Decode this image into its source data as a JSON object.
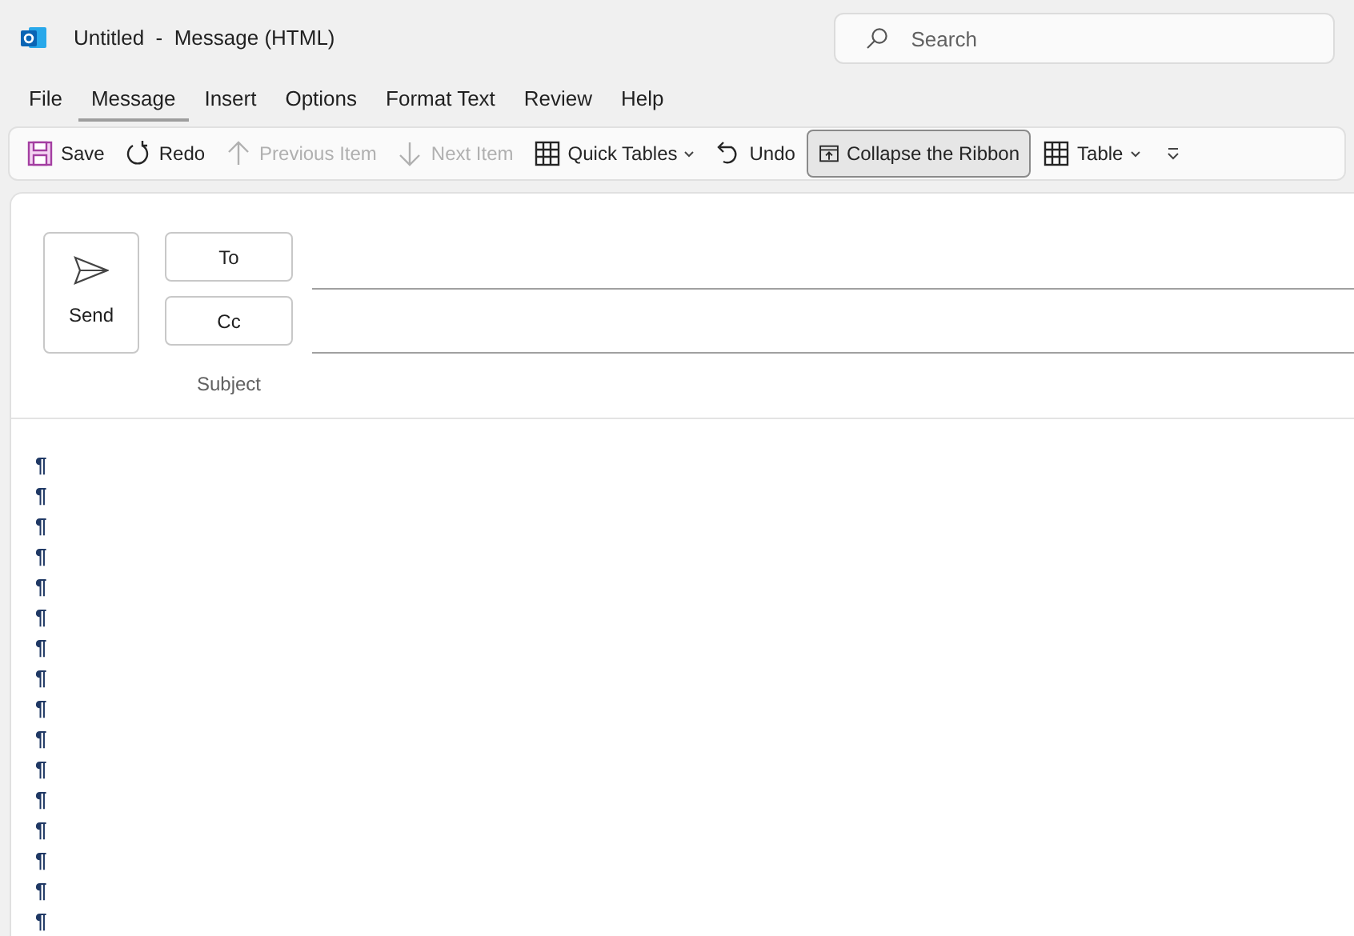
{
  "window": {
    "title": "Untitled  -  Message (HTML)"
  },
  "search": {
    "placeholder": "Search"
  },
  "tabs": [
    {
      "label": "File",
      "selected": false
    },
    {
      "label": "Message",
      "selected": true
    },
    {
      "label": "Insert",
      "selected": false
    },
    {
      "label": "Options",
      "selected": false
    },
    {
      "label": "Format Text",
      "selected": false
    },
    {
      "label": "Review",
      "selected": false
    },
    {
      "label": "Help",
      "selected": false
    }
  ],
  "toolbar": [
    {
      "label": "Save",
      "disabled": false,
      "pressed": false,
      "dropdown": false
    },
    {
      "label": "Redo",
      "disabled": false,
      "pressed": false,
      "dropdown": false
    },
    {
      "label": "Previous Item",
      "disabled": true,
      "pressed": false,
      "dropdown": false
    },
    {
      "label": "Next Item",
      "disabled": true,
      "pressed": false,
      "dropdown": false
    },
    {
      "label": "Quick Tables",
      "disabled": false,
      "pressed": false,
      "dropdown": true
    },
    {
      "label": "Undo",
      "disabled": false,
      "pressed": false,
      "dropdown": false
    },
    {
      "label": "Collapse the Ribbon",
      "disabled": false,
      "pressed": true,
      "dropdown": false
    },
    {
      "label": "Table",
      "disabled": false,
      "pressed": false,
      "dropdown": true
    }
  ],
  "compose": {
    "send": "Send",
    "to": "To",
    "cc": "Cc",
    "subject": "Subject"
  },
  "body_marks": [
    "¶",
    "¶",
    "¶",
    "¶",
    "¶",
    "¶",
    "¶",
    "¶",
    "¶",
    "¶",
    "¶",
    "¶",
    "¶",
    "¶",
    "¶",
    "¶"
  ]
}
